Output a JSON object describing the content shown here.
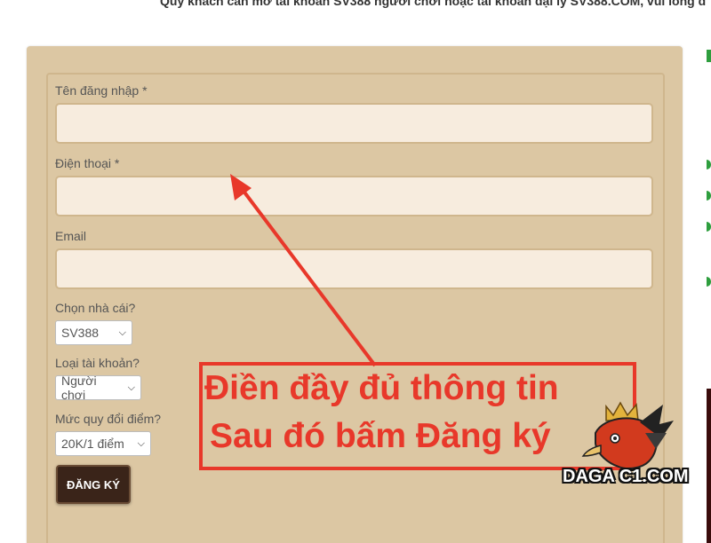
{
  "header": {
    "partial_text": "Quý khách cần mở tài khoản SV388 người chơi hoặc tài khoản đại lý SV388.COM, vui lòng đ"
  },
  "form": {
    "username_label": "Tên đăng nhập *",
    "username_value": "",
    "phone_label": "Điện thoại *",
    "phone_value": "",
    "email_label": "Email",
    "email_value": "",
    "house_label": "Chọn nhà cái?",
    "house_selected": "SV388",
    "account_type_label": "Loại tài khoản?",
    "account_type_selected": "Người chơi",
    "rate_label": "Mức quy đổi điểm?",
    "rate_selected": "20K/1 điểm",
    "submit_label": "ĐĂNG KÝ"
  },
  "annotation": {
    "line1": "Điền đầy đủ thông tin",
    "line2": "Sau đó bấm Đăng ký",
    "color": "#e8382a"
  },
  "watermark": {
    "text": "DAGA C1.COM"
  },
  "colors": {
    "panel": "#dcc7a3",
    "input_bg": "#f7ecde",
    "button_bg": "#3a2419",
    "accent_green": "#2e9e3e"
  }
}
